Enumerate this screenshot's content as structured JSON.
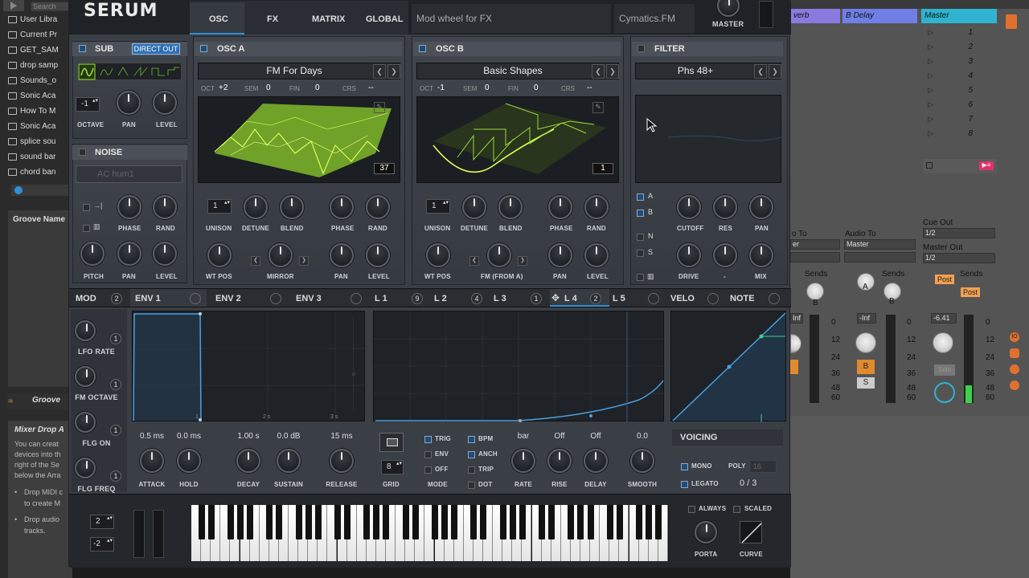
{
  "ableton": {
    "browser_items": [
      "User Libra",
      "Current Pr",
      "GET_SAM",
      "drop samp",
      "Sounds_o",
      "Sonic Aca",
      "How To M",
      "Sonic Aca",
      "splice sou",
      "sound bar",
      "chord ban"
    ],
    "search_placeholder": "Search",
    "groove_title": "Groove Name",
    "groove_pool": "Groove",
    "info_title": "Mixer Drop A",
    "info_body": [
      "You can creat",
      "devices into th",
      "right of the Se",
      "below the Arra"
    ],
    "info_bullets": [
      "Drop MIDI c",
      "to create M",
      "Drop audio",
      "tracks."
    ],
    "tracks": [
      {
        "name": "verb",
        "color": "#8a7ae0"
      },
      {
        "name": "B Delay",
        "color": "#6f7fe6"
      },
      {
        "name": "Master",
        "color": "#2fb3d0"
      }
    ],
    "scenes": [
      "1",
      "2",
      "3",
      "4",
      "5",
      "6",
      "7",
      "8"
    ],
    "audio_to_a": "o To",
    "audio_to_b": "Audio To",
    "audio_to_b_value": "Master",
    "audio_to_a_value": "er",
    "cue_out": "Cue Out",
    "cue_out_value": "1/2",
    "master_out": "Master Out",
    "master_out_value": "1/2",
    "sends_label": "Sends",
    "post_label": "Post",
    "vol_a": "Inf",
    "vol_b": "-Inf",
    "vol_master": "-6.41",
    "meter_scale": [
      "0",
      "12",
      "24",
      "36",
      "48",
      "60"
    ],
    "send_letters": [
      "A",
      "B",
      "A",
      "B"
    ],
    "solo_label": "S",
    "track_b_num": "B",
    "solo_master": "Solo"
  },
  "serum": {
    "logo": "SERUM",
    "tabs": [
      "OSC",
      "FX",
      "MATRIX",
      "GLOBAL"
    ],
    "active_tab": "OSC",
    "status_text": "Mod wheel for FX",
    "preset_author": "Cymatics.FM",
    "master_label": "MASTER",
    "sub": {
      "title": "SUB",
      "direct_out": "DIRECT OUT",
      "octave": "-1",
      "labels": [
        "OCTAVE",
        "PAN",
        "LEVEL"
      ]
    },
    "noise": {
      "title": "NOISE",
      "preset": "AC hum1",
      "labels": [
        "PHASE",
        "RAND",
        "PITCH",
        "PAN",
        "LEVEL"
      ]
    },
    "osc_a": {
      "title": "OSC A",
      "wavetable": "FM For Days",
      "oct_label": "OCT",
      "oct": "+2",
      "sem_label": "SEM",
      "sem": "0",
      "fin_label": "FIN",
      "fin": "0",
      "crs_label": "CRS",
      "crs": "--",
      "frame": "37",
      "unison": "1",
      "labels": [
        "UNISON",
        "DETUNE",
        "BLEND",
        "PHASE",
        "RAND",
        "WT POS",
        "MIRROR",
        "PAN",
        "LEVEL"
      ]
    },
    "osc_b": {
      "title": "OSC B",
      "wavetable": "Basic Shapes",
      "oct_label": "OCT",
      "oct": "-1",
      "sem_label": "SEM",
      "sem": "0",
      "fin_label": "FIN",
      "fin": "0",
      "crs_label": "CRS",
      "crs": "--",
      "frame": "1",
      "unison": "1",
      "labels": [
        "UNISON",
        "DETUNE",
        "BLEND",
        "PHASE",
        "RAND",
        "WT POS",
        "FM (FROM A)",
        "PAN",
        "LEVEL"
      ]
    },
    "filter": {
      "title": "FILTER",
      "type": "Phs 48+",
      "routes": [
        "A",
        "B",
        "N",
        "S"
      ],
      "labels": [
        "CUTOFF",
        "RES",
        "PAN",
        "DRIVE",
        "-",
        "MIX"
      ]
    },
    "mod": {
      "title": "MOD",
      "count": "2",
      "items": [
        {
          "label": "LFO RATE",
          "n": "1"
        },
        {
          "label": "FM OCTAVE",
          "n": "1"
        },
        {
          "label": "FLG ON",
          "n": "1"
        },
        {
          "label": "FLG FREQ",
          "n": "1"
        }
      ]
    },
    "env_tabs": [
      "ENV 1",
      "ENV 2",
      "ENV 3"
    ],
    "lfo_tabs": [
      {
        "name": "L 1",
        "n": "9"
      },
      {
        "name": "L 2",
        "n": "4"
      },
      {
        "name": "L 3",
        "n": "1"
      },
      {
        "name": "L 4",
        "n": "2"
      },
      {
        "name": "L 5",
        "n": ""
      }
    ],
    "velo": "VELO",
    "note": "NOTE",
    "env_ticks": [
      "1",
      "2 s",
      "3 s"
    ],
    "env_values": [
      "0.5 ms",
      "0.0 ms",
      "1.00 s",
      "0.0 dB",
      "15 ms"
    ],
    "env_labels": [
      "ATTACK",
      "HOLD",
      "DECAY",
      "SUSTAIN",
      "RELEASE"
    ],
    "lfo": {
      "grid": "8",
      "grid_label": "GRID",
      "mode_label": "MODE",
      "modes": [
        "TRIG",
        "ENV",
        "OFF"
      ],
      "flags": [
        "BPM",
        "ANCH",
        "TRIP",
        "DOT"
      ],
      "values": [
        "bar",
        "Off",
        "Off",
        "0.0"
      ],
      "labels": [
        "RATE",
        "RISE",
        "DELAY",
        "SMOOTH"
      ]
    },
    "voicing": {
      "title": "VOICING",
      "mono": "MONO",
      "poly": "POLY",
      "poly_val": "16",
      "legato": "LEGATO",
      "count": "0 / 3"
    },
    "keyboard": {
      "bend_up": "2",
      "bend_down": "-2",
      "always": "ALWAYS",
      "scaled": "SCALED",
      "porta": "PORTA",
      "curve": "CURVE"
    }
  },
  "colors": {
    "wave_green": "#a8e22a",
    "accent_blue": "#2f8fd8",
    "lfo_line": "#4aa0e0"
  }
}
